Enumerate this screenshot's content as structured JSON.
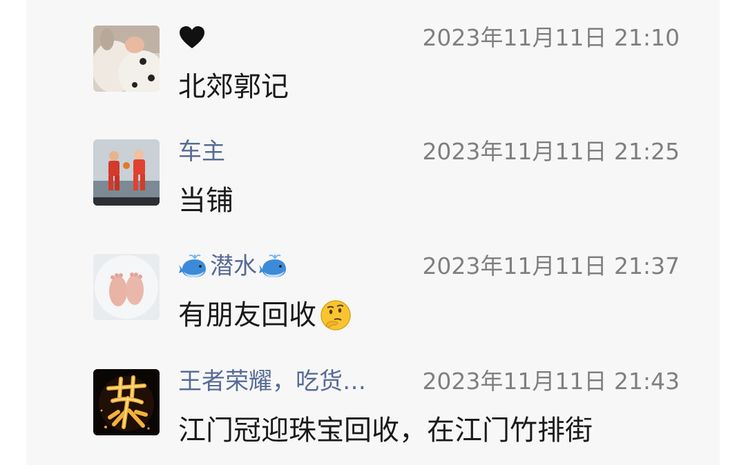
{
  "comments": [
    {
      "avatar_icon": "baby-in-bunny-outfit-avatar",
      "name": "🖤",
      "timestamp": "2023年11月11日 21:10",
      "text": "北郊郭记"
    },
    {
      "avatar_icon": "basketball-players-avatar",
      "name": "车主",
      "timestamp": "2023年11月11日 21:25",
      "text": "当铺"
    },
    {
      "avatar_icon": "baby-feet-avatar",
      "name_prefix_icon": "whale-icon",
      "name": "潜水",
      "name_suffix_icon": "whale-icon",
      "timestamp": "2023年11月11日 21:37",
      "text": "有朋友回收",
      "text_suffix_icon": "thinking-face-emoji"
    },
    {
      "avatar_icon": "golden-calligraphy-avatar",
      "name": "王者荣耀，吃货…",
      "timestamp": "2023年11月11日 21:43",
      "text": "江门冠迎珠宝回收，在江门竹排街"
    }
  ],
  "colors": {
    "background": "#f7f7f7",
    "name_link": "#576b95",
    "timestamp": "#7f7f7f",
    "body_text": "#1a1a1a"
  }
}
